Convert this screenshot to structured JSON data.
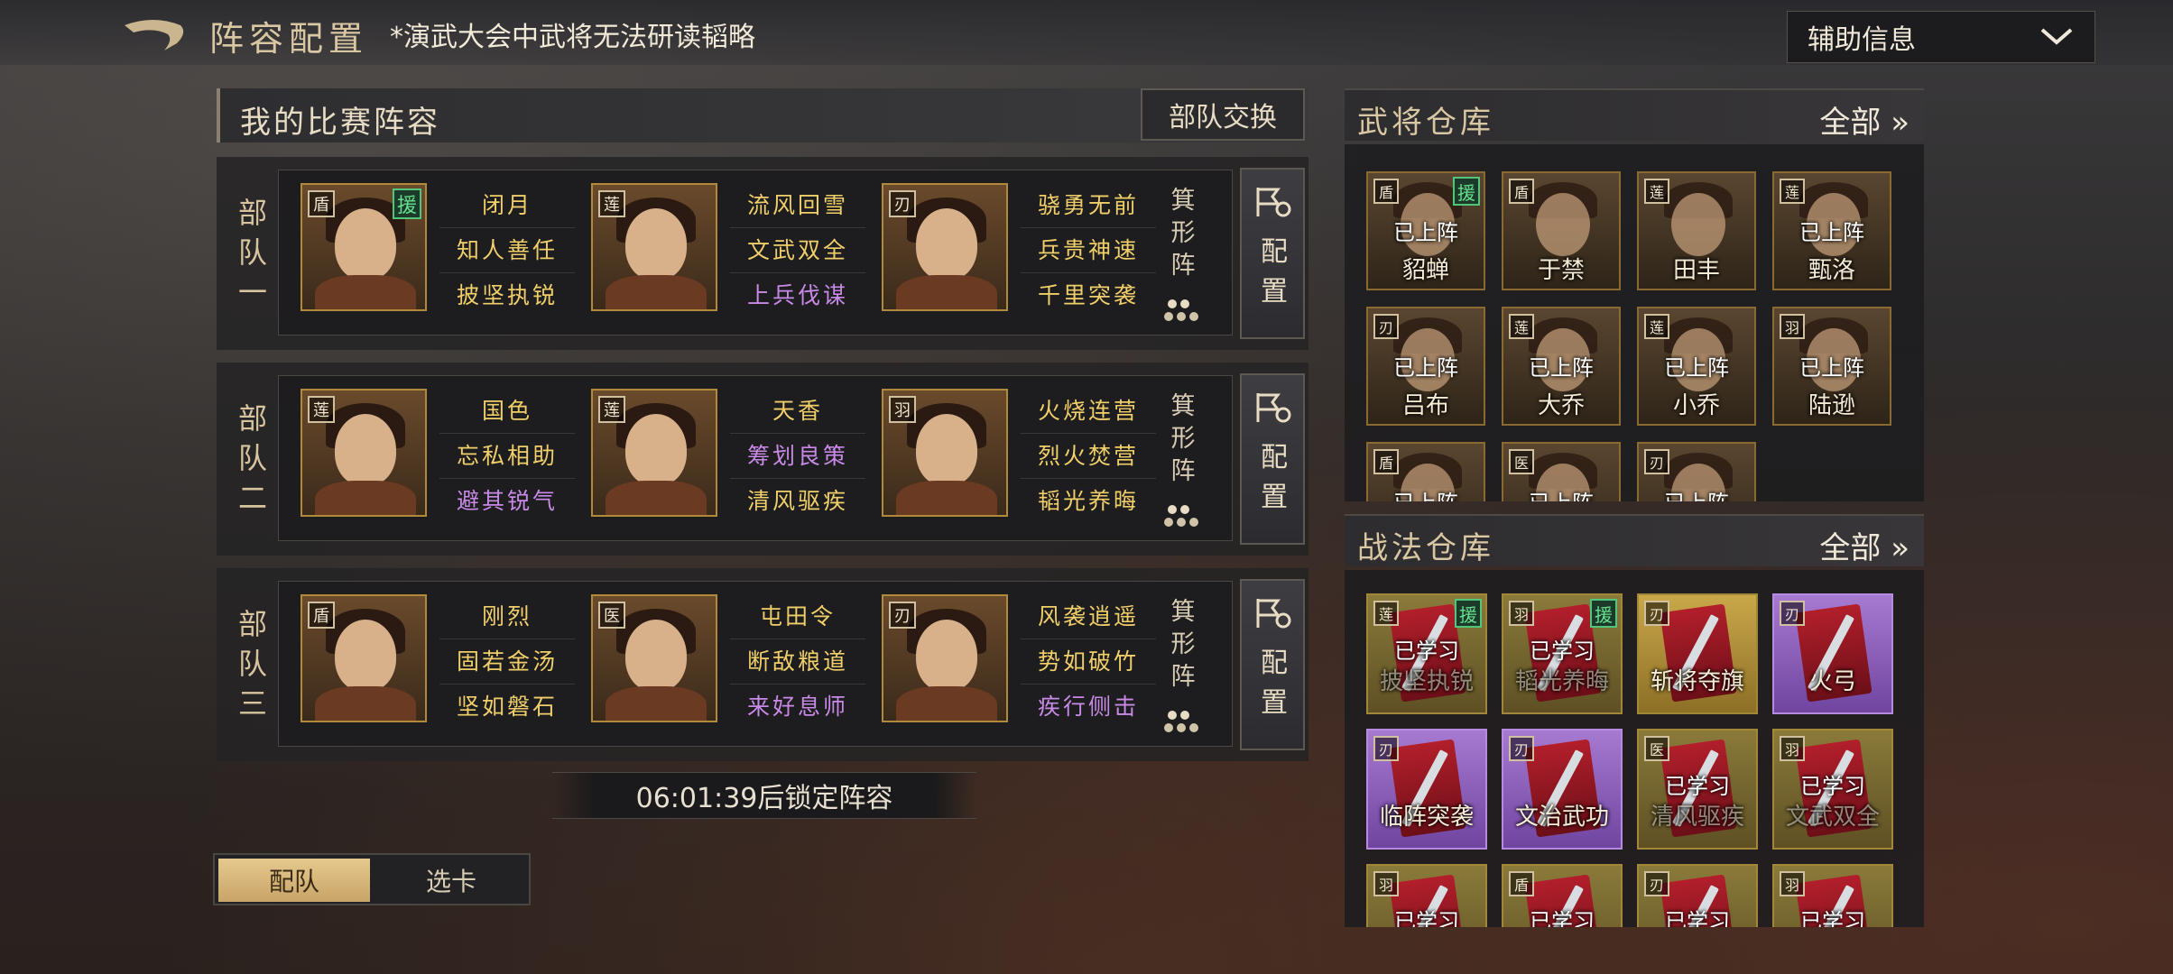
{
  "header": {
    "title": "阵容配置",
    "note": "*演武大会中武将无法研读韬略",
    "aux_dropdown": "辅助信息"
  },
  "lineup": {
    "title": "我的比赛阵容",
    "swap_button": "部队交换",
    "formation_label": "箕形阵",
    "config_label": "配置",
    "troops": [
      {
        "label": "部队一",
        "generals": [
          {
            "faction": "盾",
            "support": "援",
            "skills": [
              {
                "text": "闭月",
                "color": "gold"
              },
              {
                "text": "知人善任",
                "color": "gold"
              },
              {
                "text": "披坚执锐",
                "color": "gold"
              }
            ]
          },
          {
            "faction": "莲",
            "skills": [
              {
                "text": "流风回雪",
                "color": "gold"
              },
              {
                "text": "文武双全",
                "color": "gold"
              },
              {
                "text": "上兵伐谋",
                "color": "purple"
              }
            ]
          },
          {
            "faction": "刃",
            "skills": [
              {
                "text": "骁勇无前",
                "color": "gold"
              },
              {
                "text": "兵贵神速",
                "color": "gold"
              },
              {
                "text": "千里突袭",
                "color": "gold"
              }
            ]
          }
        ]
      },
      {
        "label": "部队二",
        "generals": [
          {
            "faction": "莲",
            "skills": [
              {
                "text": "国色",
                "color": "gold"
              },
              {
                "text": "忘私相助",
                "color": "gold"
              },
              {
                "text": "避其锐气",
                "color": "purple"
              }
            ]
          },
          {
            "faction": "莲",
            "skills": [
              {
                "text": "天香",
                "color": "gold"
              },
              {
                "text": "筹划良策",
                "color": "purple"
              },
              {
                "text": "清风驱疾",
                "color": "gold"
              }
            ]
          },
          {
            "faction": "羽",
            "skills": [
              {
                "text": "火烧连营",
                "color": "gold"
              },
              {
                "text": "烈火焚营",
                "color": "gold"
              },
              {
                "text": "韬光养晦",
                "color": "gold"
              }
            ]
          }
        ]
      },
      {
        "label": "部队三",
        "generals": [
          {
            "faction": "盾",
            "skills": [
              {
                "text": "刚烈",
                "color": "gold"
              },
              {
                "text": "固若金汤",
                "color": "gold"
              },
              {
                "text": "坚如磐石",
                "color": "gold"
              }
            ]
          },
          {
            "faction": "医",
            "skills": [
              {
                "text": "屯田令",
                "color": "gold"
              },
              {
                "text": "断敌粮道",
                "color": "gold"
              },
              {
                "text": "来好息师",
                "color": "purple"
              }
            ]
          },
          {
            "faction": "刃",
            "skills": [
              {
                "text": "风袭逍遥",
                "color": "gold"
              },
              {
                "text": "势如破竹",
                "color": "gold"
              },
              {
                "text": "疾行侧击",
                "color": "purple"
              }
            ]
          }
        ]
      }
    ],
    "lock_timer": "06:01:39后锁定阵容"
  },
  "tabs": [
    {
      "label": "配队",
      "active": true
    },
    {
      "label": "选卡",
      "active": false
    }
  ],
  "general_warehouse": {
    "title": "武将仓库",
    "all_label": "全部 »",
    "cards": [
      {
        "name": "貂蝉",
        "state": "已上阵",
        "faction": "盾",
        "support": "援"
      },
      {
        "name": "于禁",
        "state": "",
        "faction": "盾"
      },
      {
        "name": "田丰",
        "state": "",
        "faction": "莲"
      },
      {
        "name": "甄洛",
        "state": "已上阵",
        "faction": "莲"
      },
      {
        "name": "吕布",
        "state": "已上阵",
        "faction": "刃"
      },
      {
        "name": "大乔",
        "state": "已上阵",
        "faction": "莲"
      },
      {
        "name": "小乔",
        "state": "已上阵",
        "faction": "莲"
      },
      {
        "name": "陆逊",
        "state": "已上阵",
        "faction": "羽"
      },
      {
        "name": "",
        "state": "已上阵",
        "faction": "盾"
      },
      {
        "name": "",
        "state": "已上阵",
        "faction": "医"
      },
      {
        "name": "",
        "state": "已上阵",
        "faction": "刃"
      }
    ]
  },
  "tactic_warehouse": {
    "title": "战法仓库",
    "all_label": "全部 »",
    "cards": [
      {
        "name": "披坚执锐",
        "state": "已学习",
        "faction": "莲",
        "support": "援",
        "tier": "olive"
      },
      {
        "name": "韬光养晦",
        "state": "已学习",
        "faction": "羽",
        "support": "援",
        "tier": "olive"
      },
      {
        "name": "斩将夺旗",
        "state": "",
        "faction": "刃",
        "tier": "gold"
      },
      {
        "name": "火弓",
        "state": "",
        "faction": "刃",
        "tier": "purple"
      },
      {
        "name": "临阵突袭",
        "state": "",
        "faction": "刃",
        "tier": "purple"
      },
      {
        "name": "文治武功",
        "state": "",
        "faction": "刃",
        "tier": "purple"
      },
      {
        "name": "清风驱疾",
        "state": "已学习",
        "faction": "医",
        "tier": "olive"
      },
      {
        "name": "文武双全",
        "state": "已学习",
        "faction": "羽",
        "tier": "olive"
      },
      {
        "name": "",
        "state": "已学习",
        "faction": "羽",
        "tier": "olive"
      },
      {
        "name": "",
        "state": "已学习",
        "faction": "盾",
        "tier": "olive"
      },
      {
        "name": "",
        "state": "已学习",
        "faction": "刃",
        "tier": "olive"
      },
      {
        "name": "",
        "state": "已学习",
        "faction": "羽",
        "tier": "olive"
      }
    ]
  },
  "colors": {
    "skill_gold": "#f0cf6a",
    "skill_purple": "#c88ae6",
    "support_green": "#52c57a"
  }
}
